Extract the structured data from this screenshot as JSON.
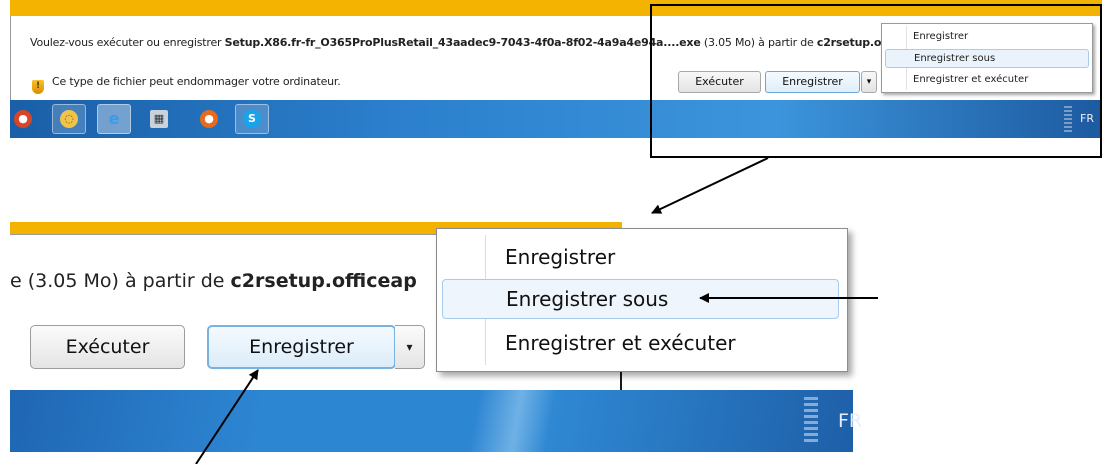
{
  "download_bar": {
    "message_prefix": "Voulez-vous exécuter ou enregistrer ",
    "file_name": "Setup.X86.fr-fr_O365ProPlusRetail_43aadec9-7043-4f0a-8f02-4a9a4e94a....exe",
    "message_middle": " (3.05 Mo) à partir de ",
    "source": "c2rsetup.officeap",
    "warning": "Ce type de fichier peut endommager votre ordinateur.",
    "run_label": "Exécuter",
    "save_label": "Enregistrer",
    "dropdown_arrow": "▾"
  },
  "save_menu": {
    "items": [
      {
        "label": "Enregistrer"
      },
      {
        "label": "Enregistrer sous"
      },
      {
        "label": "Enregistrer et exécuter"
      }
    ],
    "highlighted_index": 1
  },
  "taskbar": {
    "language": "FR",
    "apps": [
      "chrome-icon",
      "outlook-icon",
      "internet-explorer-icon",
      "calculator-icon",
      "firefox-icon",
      "skype-icon"
    ]
  },
  "zoom": {
    "message": "e (3.05 Mo) à partir de ",
    "source": "c2rsetup.officeap",
    "run_label": "Exécuter",
    "save_label": "Enregistrer",
    "dropdown_arrow": "▾",
    "language": "FR"
  },
  "colors": {
    "strip": "#f3b300",
    "taskbar": "#2b7fcc",
    "menu_highlight": "#eaf3fc",
    "annotation": "#000000"
  }
}
